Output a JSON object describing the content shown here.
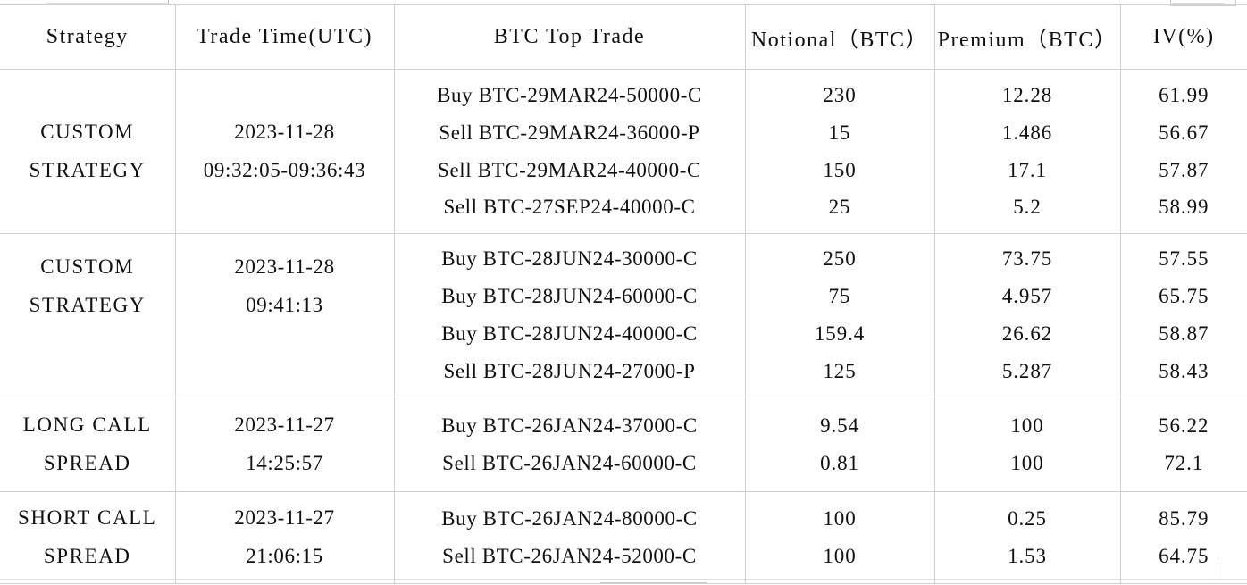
{
  "table": {
    "columns": [
      {
        "key": "strategy",
        "label": "Strategy"
      },
      {
        "key": "trade_time",
        "label": "Trade Time(UTC)"
      },
      {
        "key": "top_trade",
        "label": "BTC Top Trade"
      },
      {
        "key": "notional",
        "label": "Notional（BTC）"
      },
      {
        "key": "premium",
        "label": "Premium（BTC）"
      },
      {
        "key": "iv",
        "label": "IV(%)"
      }
    ],
    "rows": [
      {
        "strategy_lines": [
          "CUSTOM",
          "STRATEGY"
        ],
        "time_lines": [
          "2023-11-28",
          "09:32:05-09:36:43"
        ],
        "trades": [
          {
            "trade": "Buy  BTC-29MAR24-50000-C",
            "notional": "230",
            "premium": "12.28",
            "iv": "61.99"
          },
          {
            "trade": "Sell BTC-29MAR24-36000-P",
            "notional": "15",
            "premium": "1.486",
            "iv": "56.67"
          },
          {
            "trade": "Sell BTC-29MAR24-40000-C",
            "notional": "150",
            "premium": "17.1",
            "iv": "57.87"
          },
          {
            "trade": "Sell BTC-27SEP24-40000-C",
            "notional": "25",
            "premium": "5.2",
            "iv": "58.99"
          }
        ]
      },
      {
        "strategy_lines": [
          "CUSTOM",
          "STRATEGY"
        ],
        "time_lines": [
          "2023-11-28",
          "09:41:13"
        ],
        "trades": [
          {
            "trade": "Buy  BTC-28JUN24-30000-C",
            "notional": "250",
            "premium": "73.75",
            "iv": "57.55"
          },
          {
            "trade": "Buy  BTC-28JUN24-60000-C",
            "notional": "75",
            "premium": "4.957",
            "iv": "65.75"
          },
          {
            "trade": "Buy  BTC-28JUN24-40000-C",
            "notional": "159.4",
            "premium": "26.62",
            "iv": "58.87"
          },
          {
            "trade": "Sell BTC-28JUN24-27000-P",
            "notional": "125",
            "premium": "5.287",
            "iv": "58.43"
          }
        ]
      },
      {
        "strategy_lines": [
          "LONG CALL",
          "SPREAD"
        ],
        "time_lines": [
          "2023-11-27",
          "14:25:57"
        ],
        "trades": [
          {
            "trade": "Buy  BTC-26JAN24-37000-C",
            "notional": "9.54",
            "premium": "100",
            "iv": "56.22"
          },
          {
            "trade": "Sell BTC-26JAN24-60000-C",
            "notional": "0.81",
            "premium": "100",
            "iv": "72.1"
          }
        ]
      },
      {
        "strategy_lines": [
          "SHORT CALL",
          "SPREAD"
        ],
        "time_lines": [
          "2023-11-27",
          "21:06:15"
        ],
        "trades": [
          {
            "trade": "Buy  BTC-26JAN24-80000-C",
            "notional": "100",
            "premium": "0.25",
            "iv": "85.79"
          },
          {
            "trade": "Sell BTC-26JAN24-52000-C",
            "notional": "100",
            "premium": "1.53",
            "iv": "64.75"
          }
        ]
      }
    ]
  },
  "colors": {
    "grid_line": "#d0d0d0",
    "text": "#111111",
    "background": "#ffffff"
  }
}
